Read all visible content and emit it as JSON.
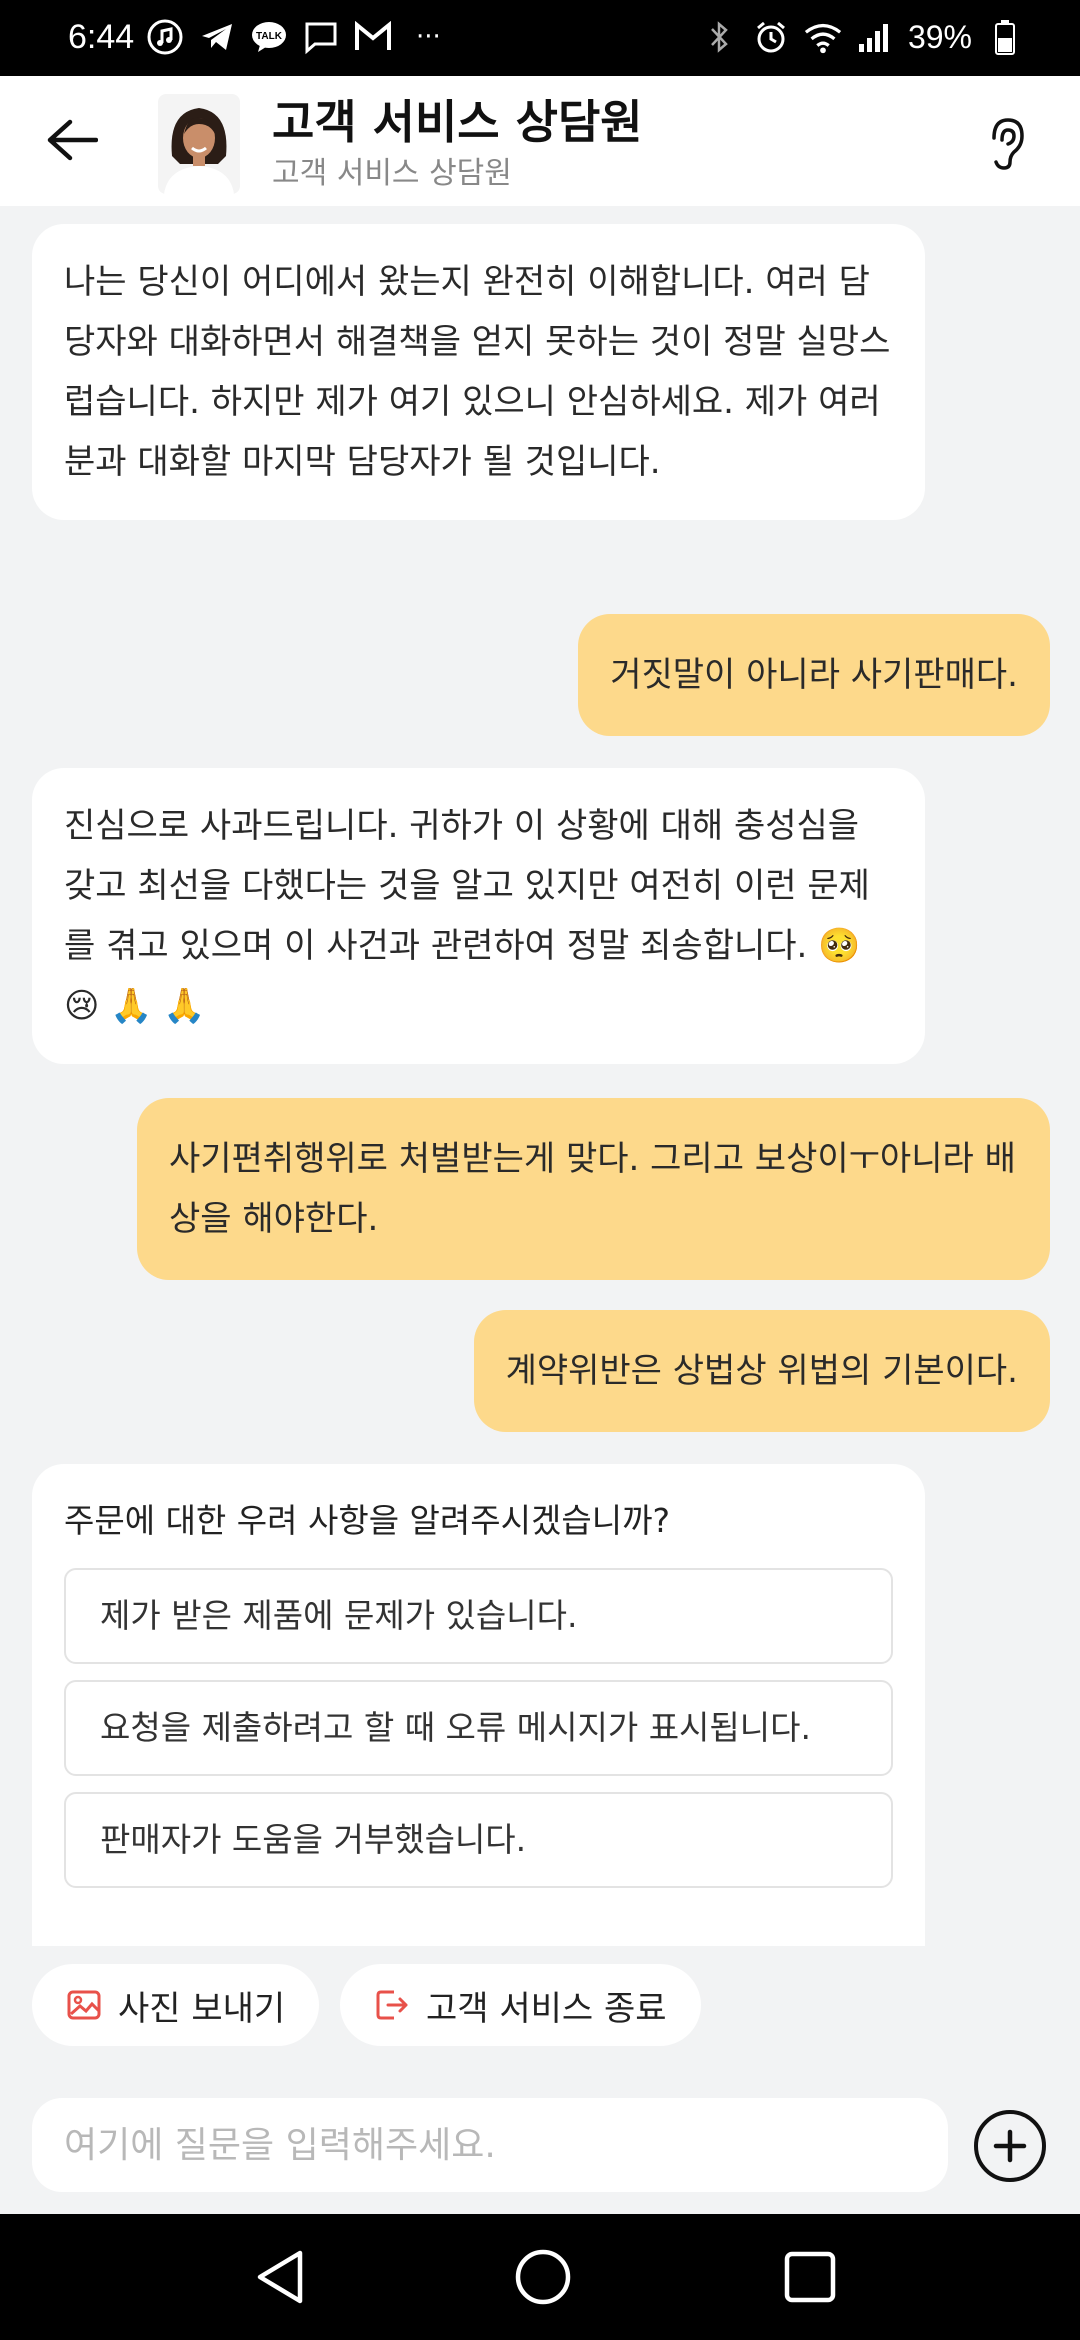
{
  "status_bar": {
    "time": "6:44",
    "battery": "39%",
    "more": "···",
    "left_icons": [
      "music-icon",
      "telegram-icon",
      "talk-icon",
      "message-icon",
      "gmail-icon"
    ],
    "right_icons": [
      "bluetooth-icon",
      "alarm-icon",
      "wifi-icon",
      "signal-icon",
      "battery-icon"
    ]
  },
  "header": {
    "title": "고객 서비스 상담원",
    "subtitle": "고객 서비스 상담원"
  },
  "messages": [
    {
      "sender": "bot",
      "text": "나는 당신이 어디에서 왔는지 완전히 이해합니다. 여러 담당자와 대화하면서 해결책을 얻지 못하는 것이 정말 실망스럽습니다. 하지만 제가 여기 있으니 안심하세요. 제가 여러분과 대화할 마지막 담당자가 될 것입니다."
    },
    {
      "sender": "user",
      "text": "거짓말이 아니라 사기판매다."
    },
    {
      "sender": "bot",
      "text": "진심으로 사과드립니다. 귀하가 이 상황에 대해 충성심을 갖고 최선을 다했다는 것을 알고 있지만 여전히 이런 문제를 겪고 있으며 이 사건과 관련하여 정말 죄송합니다.",
      "emojis": "🥺 😢 🙏 🙏"
    },
    {
      "sender": "user",
      "text": "사기편취행위로 처벌받는게 맞다. 그리고 보상이ㅜ아니라 배상을 해야한다."
    },
    {
      "sender": "user",
      "text": "계약위반은 상법상 위법의 기본이다."
    }
  ],
  "options_card": {
    "question": "주문에 대한 우려 사항을 알려주시겠습니까?",
    "options": [
      "제가 받은 제품에 문제가 있습니다.",
      "요청을 제출하려고 할 때 오류 메시지가 표시됩니다.",
      "판매자가 도움을 거부했습니다."
    ]
  },
  "quick_actions": {
    "send_photo": "사진 보내기",
    "end_service": "고객 서비스 종료"
  },
  "input": {
    "placeholder": "여기에 질문을 입력해주세요.",
    "value": ""
  },
  "colors": {
    "user_bubble": "#fdd98b",
    "bot_bubble": "#ffffff",
    "background": "#f2f3f4",
    "accent_red": "#e8514a"
  }
}
